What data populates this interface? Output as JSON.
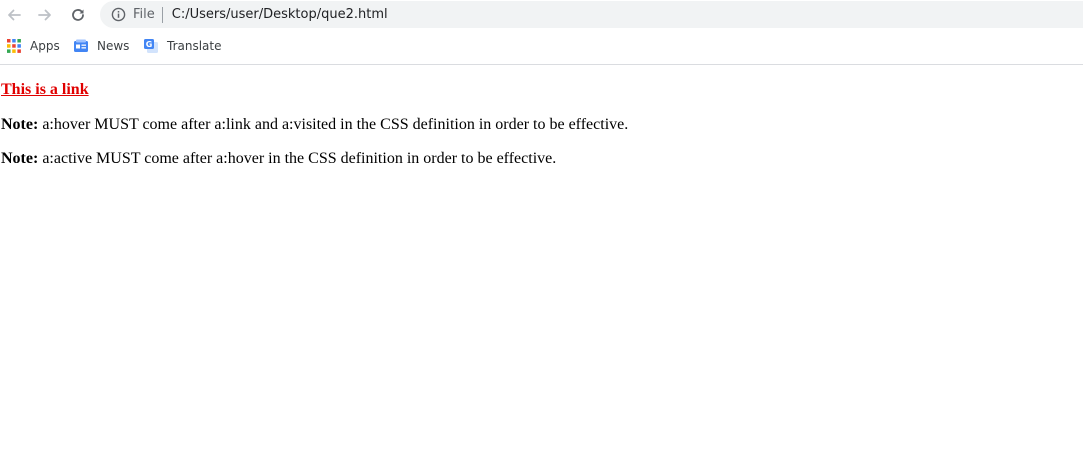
{
  "browser": {
    "scheme_label": "File",
    "url": "C:/Users/user/Desktop/que2.html"
  },
  "bookmarks": [
    {
      "label": "Apps",
      "icon": "apps-grid-icon"
    },
    {
      "label": "News",
      "icon": "news-icon"
    },
    {
      "label": "Translate",
      "icon": "translate-icon"
    }
  ],
  "page": {
    "link_text": "This is a link",
    "link_color": "#e00000",
    "notes": [
      {
        "label": "Note:",
        "text": " a:hover MUST come after a:link and a:visited in the CSS definition in order to be effective."
      },
      {
        "label": "Note:",
        "text": " a:active MUST come after a:hover in the CSS definition in order to be effective."
      }
    ]
  }
}
